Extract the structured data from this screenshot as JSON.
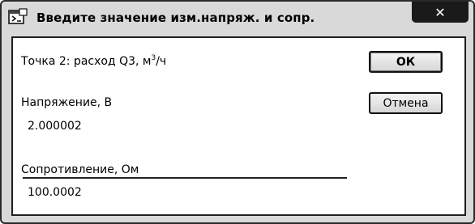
{
  "window": {
    "title": "Введите значение изм.напряж. и сопр.",
    "close_glyph": "✕"
  },
  "dialog": {
    "prompt_prefix": "Точка 2: расход Q3, м",
    "prompt_sup": "3",
    "prompt_suffix": "/ч",
    "voltage_label": "Напряжение, В",
    "voltage_value": "2.000002",
    "resistance_label": "Сопротивление, Ом",
    "resistance_value": "100.0002"
  },
  "buttons": {
    "ok": "ОК",
    "cancel": "Отмена"
  },
  "icons": {
    "app": "dialog-app-icon",
    "close": "close-icon"
  }
}
